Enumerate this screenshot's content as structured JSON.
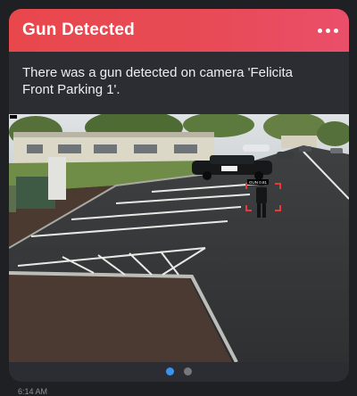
{
  "notification": {
    "title": "Gun Detected",
    "message": "There was a gun detected on camera 'Felicita Front Parking 1'.",
    "more_icon": "more-horizontal-icon",
    "accent_color": "#e8484c"
  },
  "snapshot": {
    "detection_label": "GUN 0.81"
  },
  "pager": {
    "page_count": 2,
    "active_index": 0
  },
  "timestamp": "6:14 AM"
}
